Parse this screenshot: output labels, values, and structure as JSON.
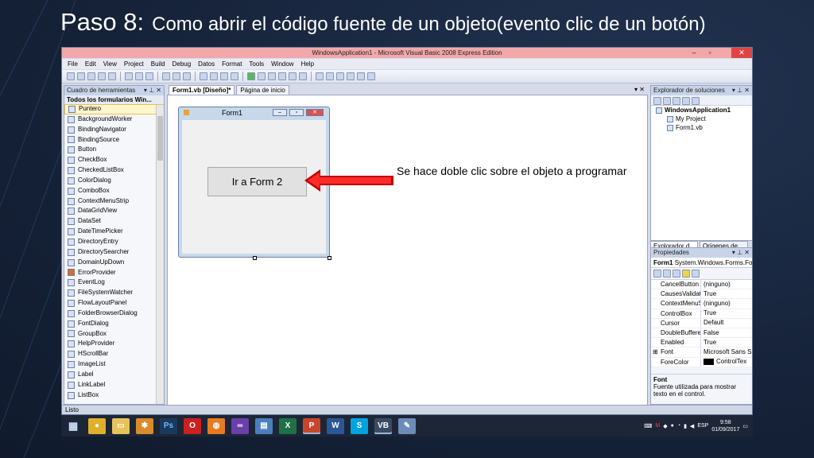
{
  "slide": {
    "step": "Paso 8:",
    "subtitle": "Como abrir el código fuente  de un objeto(evento clic de un botón)"
  },
  "window": {
    "title": "WindowsApplication1 - Microsoft Visual Basic 2008 Express Edition",
    "menu": [
      "File",
      "Edit",
      "View",
      "Project",
      "Build",
      "Debug",
      "Datos",
      "Format",
      "Tools",
      "Window",
      "Help"
    ]
  },
  "toolbox": {
    "header": "Cuadro de herramientas",
    "section": "Todos los formularios Win...",
    "items": [
      "Puntero",
      "BackgroundWorker",
      "BindingNavigator",
      "BindingSource",
      "Button",
      "CheckBox",
      "CheckedListBox",
      "ColorDialog",
      "ComboBox",
      "ContextMenuStrip",
      "DataGridView",
      "DataSet",
      "DateTimePicker",
      "DirectoryEntry",
      "DirectorySearcher",
      "DomainUpDown",
      "ErrorProvider",
      "EventLog",
      "FileSystemWatcher",
      "FlowLayoutPanel",
      "FolderBrowserDialog",
      "FontDialog",
      "GroupBox",
      "HelpProvider",
      "HScrollBar",
      "ImageList",
      "Label",
      "LinkLabel",
      "ListBox"
    ]
  },
  "document": {
    "tabs": [
      "Form1.vb [Diseño]*",
      "Página de inicio"
    ],
    "form_title": "Form1",
    "button_text": "Ir a Form 2",
    "annotation": "Se hace doble clic sobre el objeto a programar"
  },
  "solution_explorer": {
    "header": "Explorador de soluciones",
    "nodes": [
      "WindowsApplication1",
      "My Project",
      "Form1.vb"
    ],
    "tabs": [
      "Explorador d...",
      "Orígenes de ..."
    ]
  },
  "properties": {
    "header": "Propiedades",
    "object_name": "Form1",
    "object_type": "System.Windows.Forms.Fo",
    "rows": [
      {
        "name": "CancelButton",
        "value": "(ninguno)"
      },
      {
        "name": "CausesValidati",
        "value": "True"
      },
      {
        "name": "ContextMenuS",
        "value": "(ninguno)"
      },
      {
        "name": "ControlBox",
        "value": "True"
      },
      {
        "name": "Cursor",
        "value": "Default"
      },
      {
        "name": "DoubleBuffere",
        "value": "False"
      },
      {
        "name": "Enabled",
        "value": "True"
      },
      {
        "name": "Font",
        "value": "Microsoft Sans S"
      },
      {
        "name": "ForeColor",
        "value": "ControlTex"
      }
    ],
    "desc_title": "Font",
    "desc_text": "Fuente utilizada para mostrar texto en el control."
  },
  "status": {
    "text": "Listo"
  },
  "taskbar": {
    "apps": [
      {
        "icon": "windows-icon",
        "label": "",
        "color": "#1d2636"
      },
      {
        "icon": "chrome-icon",
        "label": "",
        "color": "#e0b02a"
      },
      {
        "icon": "folder-icon",
        "label": "",
        "color": "#e6c35a"
      },
      {
        "icon": "settings-app-icon",
        "label": "",
        "color": "#d98a2b"
      },
      {
        "icon": "photoshop-icon",
        "label": "Ps",
        "color": "#1a3a5c"
      },
      {
        "icon": "opera-icon",
        "label": "O",
        "color": "#cc1f1f"
      },
      {
        "icon": "firefox-icon",
        "label": "",
        "color": "#e87a21"
      },
      {
        "icon": "visual-studio-icon",
        "label": "",
        "color": "#6b3fa8"
      },
      {
        "icon": "notepad-icon",
        "label": "",
        "color": "#4a7fbf"
      },
      {
        "icon": "excel-icon",
        "label": "X",
        "color": "#1e7145"
      },
      {
        "icon": "powerpoint-icon",
        "label": "P",
        "color": "#c9452a"
      },
      {
        "icon": "word-icon",
        "label": "W",
        "color": "#2b5797"
      },
      {
        "icon": "skype-icon",
        "label": "S",
        "color": "#00a2e0"
      },
      {
        "icon": "vb-express-icon",
        "label": "VB",
        "color": "#3a4a66"
      },
      {
        "icon": "paint-icon",
        "label": "",
        "color": "#6d8bb8"
      }
    ],
    "language": "ESP",
    "time": "9:58",
    "date": "01/09/2017"
  }
}
